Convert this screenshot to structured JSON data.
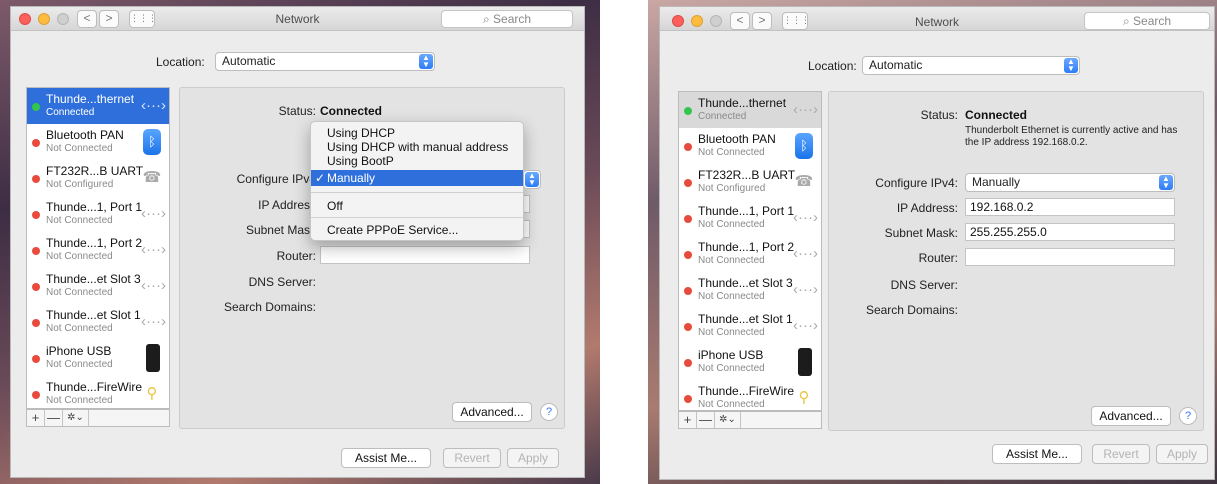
{
  "window_title": "Network",
  "search_placeholder": "Search",
  "location": {
    "label": "Location:",
    "value": "Automatic"
  },
  "services": [
    {
      "name": "Thunde...thernet",
      "status": "Connected",
      "dot": "green",
      "icon": "ethernet-icon"
    },
    {
      "name": "Bluetooth PAN",
      "status": "Not Connected",
      "dot": "red",
      "icon": "bluetooth-icon"
    },
    {
      "name": "FT232R...B UART",
      "status": "Not Configured",
      "dot": "red",
      "icon": "modem-phone-icon"
    },
    {
      "name": "Thunde...1, Port 1",
      "status": "Not Connected",
      "dot": "red",
      "icon": "ethernet-icon"
    },
    {
      "name": "Thunde...1, Port 2",
      "status": "Not Connected",
      "dot": "red",
      "icon": "ethernet-icon"
    },
    {
      "name": "Thunde...et Slot 3",
      "status": "Not Connected",
      "dot": "red",
      "icon": "ethernet-icon"
    },
    {
      "name": "Thunde...et Slot 1",
      "status": "Not Connected",
      "dot": "red",
      "icon": "ethernet-icon"
    },
    {
      "name": "iPhone USB",
      "status": "Not Connected",
      "dot": "red",
      "icon": "iphone-icon"
    },
    {
      "name": "Thunde...FireWire",
      "status": "Not Connected",
      "dot": "red",
      "icon": "firewire-icon"
    }
  ],
  "sidebar_buttons": {
    "add": "+",
    "remove": "—",
    "gear": "✲⌄"
  },
  "labels": {
    "status": "Status:",
    "configure": "Configure IPv4:",
    "configure_cut": "Configure IPv4",
    "ip": "IP Address:",
    "ip_cut": "IP Address",
    "subnet": "Subnet Mask:",
    "subnet_cut": "Subnet Mask",
    "router": "Router:",
    "dns": "DNS Server:",
    "search_domains": "Search Domains:"
  },
  "values": {
    "status": "Connected",
    "status_note": "Thunderbolt Ethernet is currently active and has the IP address 192.168.0.2.",
    "configure": "Manually",
    "ip": "192.168.0.2",
    "subnet": "255.255.255.0",
    "router": ""
  },
  "configure_menu": {
    "group1": [
      "Using DHCP",
      "Using DHCP with manual address",
      "Using BootP"
    ],
    "selected": "Manually",
    "checkmark": "✓",
    "off": "Off",
    "pppoe": "Create PPPoE Service..."
  },
  "buttons": {
    "advanced": "Advanced...",
    "help": "?",
    "assist": "Assist Me...",
    "revert": "Revert",
    "apply": "Apply"
  },
  "nav": {
    "back": "<",
    "forward": ">",
    "grid": "⋮⋮⋮"
  },
  "colors": {
    "accent": "#2f6fdc",
    "connected": "#34c64a",
    "not_connected": "#e84a3c"
  }
}
